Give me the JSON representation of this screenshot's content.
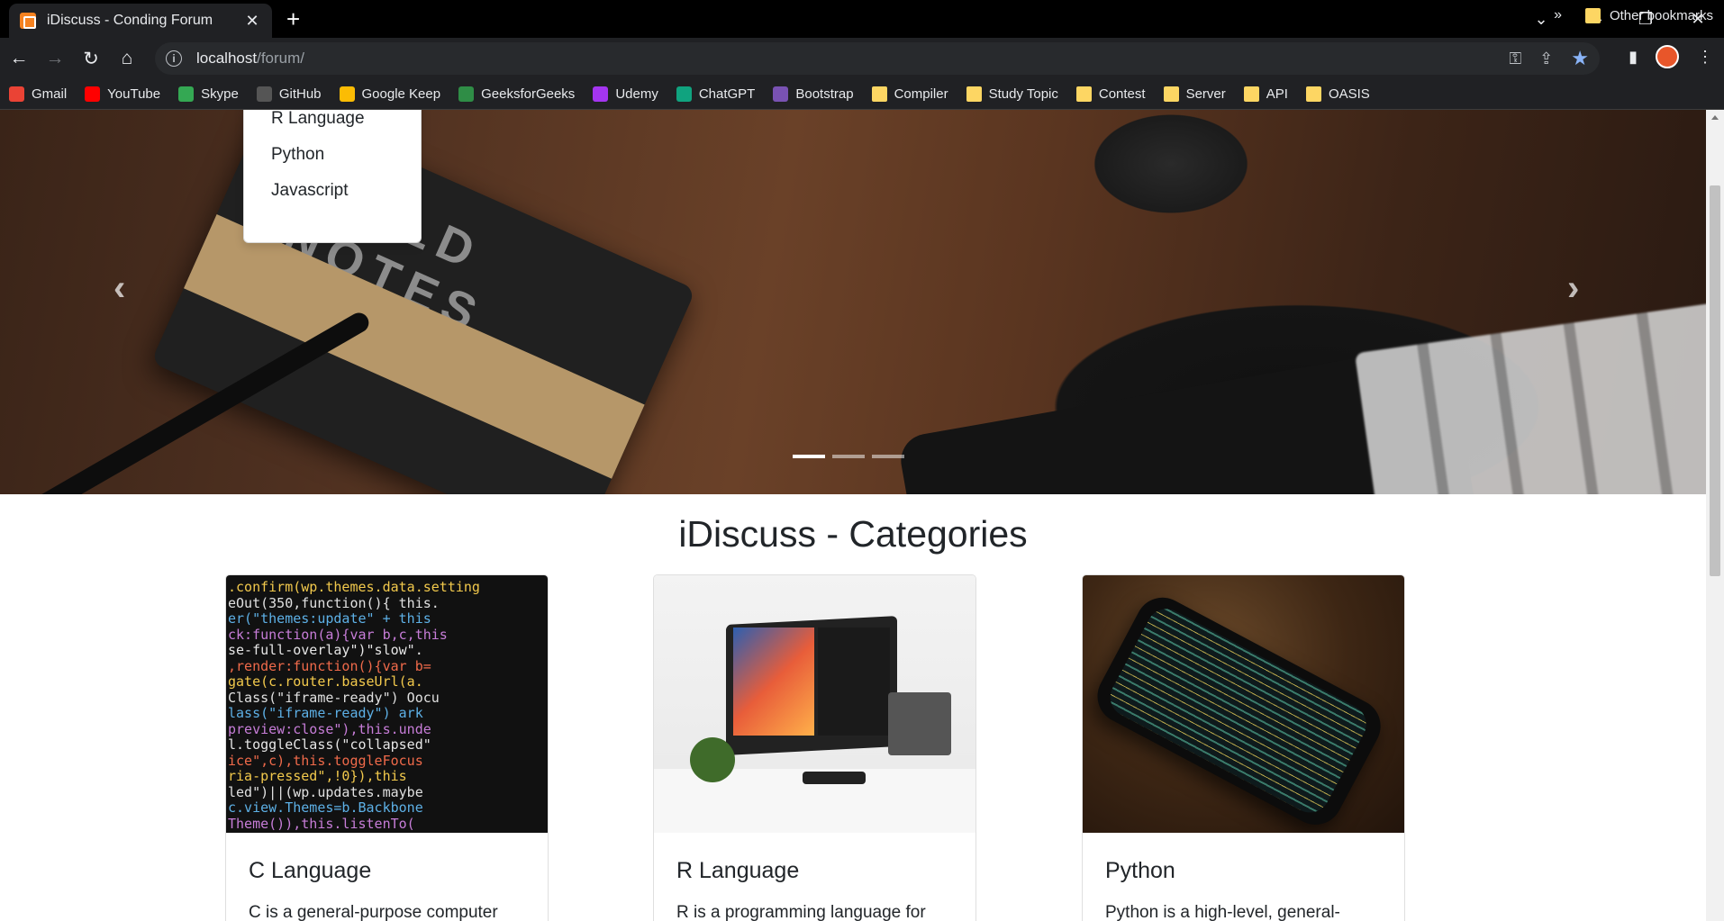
{
  "browser": {
    "tab_title": "iDiscuss - Conding Forum",
    "url_host": "localhost",
    "url_path": "/forum/"
  },
  "bookmarks": [
    {
      "label": "Gmail",
      "color": "#ea4335"
    },
    {
      "label": "YouTube",
      "color": "#ff0000"
    },
    {
      "label": "Skype",
      "color": "#34a853"
    },
    {
      "label": "GitHub",
      "color": "#555555"
    },
    {
      "label": "Google Keep",
      "color": "#fbbc04"
    },
    {
      "label": "GeeksforGeeks",
      "color": "#2f8d46"
    },
    {
      "label": "Udemy",
      "color": "#a435f0"
    },
    {
      "label": "ChatGPT",
      "color": "#10a37f"
    },
    {
      "label": "Bootstrap",
      "color": "#7952b3"
    },
    {
      "label": "Compiler",
      "color": "folder"
    },
    {
      "label": "Study Topic",
      "color": "folder"
    },
    {
      "label": "Contest",
      "color": "folder"
    },
    {
      "label": "Server",
      "color": "folder"
    },
    {
      "label": "API",
      "color": "folder"
    },
    {
      "label": "OASIS",
      "color": "folder"
    }
  ],
  "bookmarks_more": "»",
  "other_bookmarks": "Other bookmarks",
  "dropdown": {
    "items": [
      "R Language",
      "Python",
      "Javascript"
    ]
  },
  "hero": {
    "notebook_text": "FIELD NOTES",
    "prev_arrow": "‹",
    "next_arrow": "›"
  },
  "categories_heading": "iDiscuss - Categories",
  "cards": [
    {
      "title": "C Language",
      "text": "C is a general-purpose computer"
    },
    {
      "title": "R Language",
      "text": "R is a programming language for"
    },
    {
      "title": "Python",
      "text": "Python is a high-level, general-"
    }
  ]
}
